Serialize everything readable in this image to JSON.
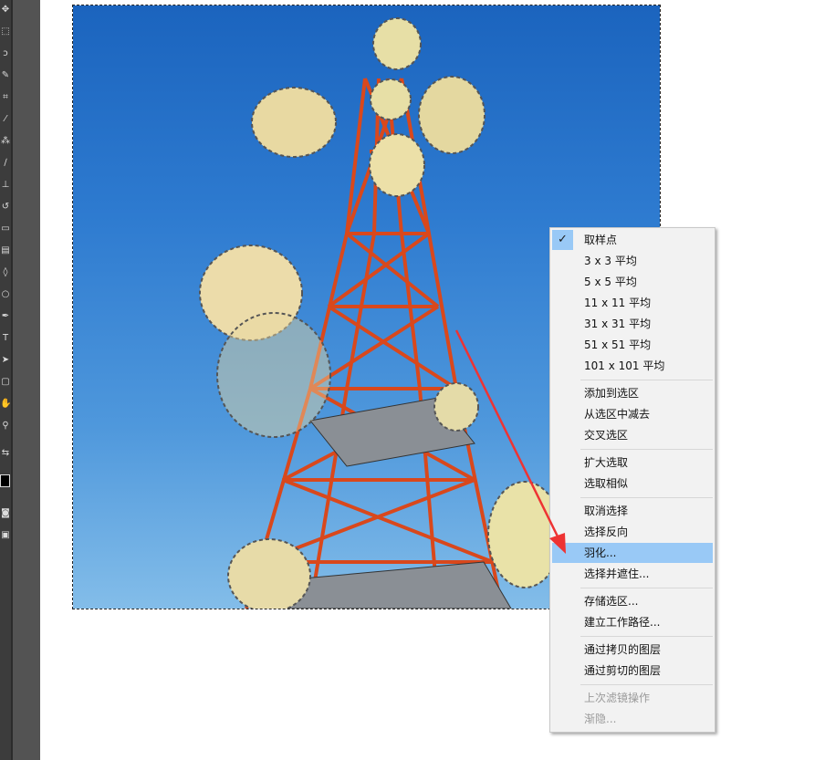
{
  "toolbar": {
    "tools": [
      "move-icon",
      "marquee-icon",
      "lasso-icon",
      "quick-select-icon",
      "crop-icon",
      "eyedropper-icon",
      "healing-icon",
      "brush-icon",
      "stamp-icon",
      "history-brush-icon",
      "eraser-icon",
      "gradient-icon",
      "blur-icon",
      "dodge-icon",
      "pen-icon",
      "type-icon",
      "path-select-icon",
      "shape-icon",
      "hand-icon",
      "zoom-icon"
    ]
  },
  "menu": {
    "items": [
      {
        "label": "取样点",
        "checked": true
      },
      {
        "label": "3 x 3 平均"
      },
      {
        "label": "5 x 5 平均"
      },
      {
        "label": "11 x 11 平均"
      },
      {
        "label": "31 x 31 平均"
      },
      {
        "label": "51 x 51 平均"
      },
      {
        "label": "101 x 101 平均"
      },
      {
        "label": "添加到选区"
      },
      {
        "label": "从选区中减去"
      },
      {
        "label": "交叉选区"
      },
      {
        "label": "扩大选取"
      },
      {
        "label": "选取相似"
      },
      {
        "label": "取消选择"
      },
      {
        "label": "选择反向"
      },
      {
        "label": "羽化...",
        "selected": true
      },
      {
        "label": "选择并遮住..."
      },
      {
        "label": "存储选区..."
      },
      {
        "label": "建立工作路径..."
      },
      {
        "label": "通过拷贝的图层"
      },
      {
        "label": "通过剪切的图层"
      },
      {
        "label": "上次滤镜操作",
        "disabled": true
      },
      {
        "label": "渐隐...",
        "disabled": true
      }
    ],
    "check_glyph": "✓"
  },
  "colors": {
    "highlight": "#99c9f6",
    "arrow": "#ee3333",
    "tower_red": "#d9481c",
    "sky": "#2e7bd0"
  }
}
